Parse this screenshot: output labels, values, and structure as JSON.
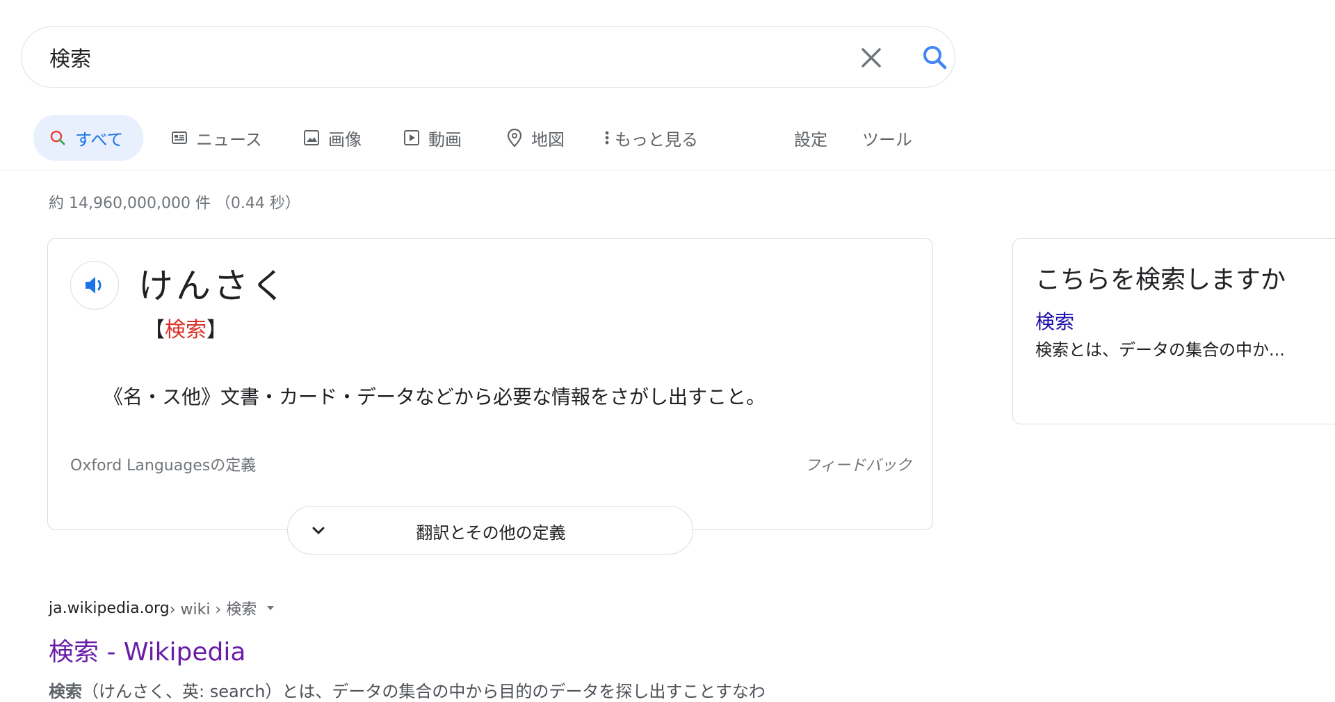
{
  "search": {
    "query": "検索"
  },
  "tabs": {
    "all": "すべて",
    "news": "ニュース",
    "images": "画像",
    "videos": "動画",
    "maps": "地図",
    "more": "もっと見る",
    "settings": "設定",
    "tools": "ツール"
  },
  "result_stats": "約 14,960,000,000 件 （0.44 秒）",
  "dictionary": {
    "reading": "けんさく",
    "bracket_open": "【",
    "kanji": "検索",
    "bracket_close": "】",
    "definition": "《名・ス他》文書・カード・データなどから必要な情報をさがし出すこと。",
    "source": "Oxford Languagesの定義",
    "feedback": "フィードバック",
    "expand_label": "翻訳とその他の定義"
  },
  "suggestion": {
    "title": "こちらを検索しますか",
    "link": "検索",
    "snippet": "検索とは、データの集合の中か..."
  },
  "result": {
    "domain": "ja.wikipedia.org",
    "path": " › wiki › 検索",
    "title": "検索 - Wikipedia",
    "snippet_bold": "検索",
    "snippet_rest": "（けんさく、英: search）とは、データの集合の中から目的のデータを探し出すことすなわ"
  },
  "colors": {
    "accent": "#1a73e8",
    "active_tab_bg": "#e8f0fe",
    "kanji_red": "#d93025",
    "link_blue": "#1a0dab",
    "visited_purple": "#681da8"
  }
}
